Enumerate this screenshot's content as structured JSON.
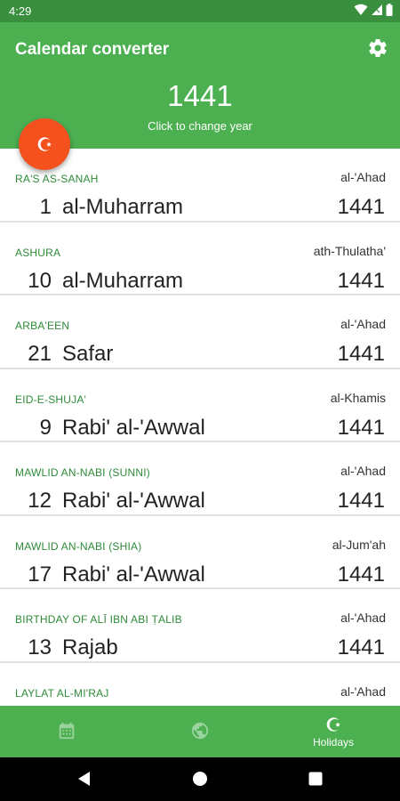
{
  "status_bar": {
    "time": "4:29"
  },
  "header": {
    "title": "Calendar converter",
    "year": "1441",
    "hint": "Click to change year"
  },
  "holidays": [
    {
      "name": "RA'S AS-SANAH",
      "weekday": "al-'Ahad",
      "day": "1",
      "month": "al-Muharram",
      "year": "1441"
    },
    {
      "name": "ASHURA",
      "weekday": "ath-Thulatha'",
      "day": "10",
      "month": "al-Muharram",
      "year": "1441"
    },
    {
      "name": "ARBA'EEN",
      "weekday": "al-'Ahad",
      "day": "21",
      "month": "Safar",
      "year": "1441"
    },
    {
      "name": "EID-E-SHUJA'",
      "weekday": "al-Khamis",
      "day": "9",
      "month": "Rabi' al-'Awwal",
      "year": "1441"
    },
    {
      "name": "MAWLID AN-NABI (SUNNI)",
      "weekday": "al-'Ahad",
      "day": "12",
      "month": "Rabi' al-'Awwal",
      "year": "1441"
    },
    {
      "name": "MAWLID AN-NABI (SHIA)",
      "weekday": "al-Jum'ah",
      "day": "17",
      "month": "Rabi' al-'Awwal",
      "year": "1441"
    },
    {
      "name": "BIRTHDAY OF ALĪ IBN ABI ṬALIB",
      "weekday": "al-'Ahad",
      "day": "13",
      "month": "Rajab",
      "year": "1441"
    },
    {
      "name": "LAYLAT AL-MI'RAJ",
      "weekday": "al-'Ahad",
      "day": "",
      "month": "",
      "year": ""
    }
  ],
  "bottom_nav": {
    "items": [
      {
        "icon": "calendar-icon",
        "label": ""
      },
      {
        "icon": "globe-icon",
        "label": ""
      },
      {
        "icon": "crescent-star-icon",
        "label": "Holidays"
      }
    ]
  },
  "colors": {
    "primary": "#4caf50",
    "primary_dark": "#3a8f3f",
    "accent": "#f4511e",
    "holiday_name": "#2e8b3a"
  }
}
